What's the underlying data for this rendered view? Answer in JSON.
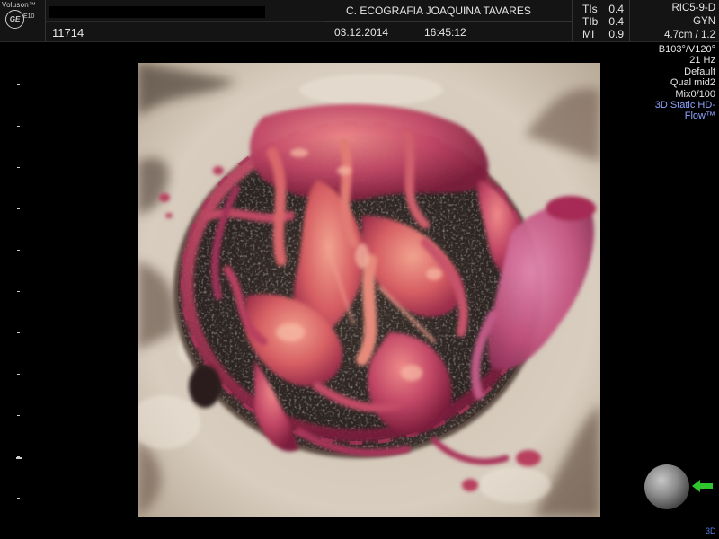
{
  "header": {
    "brand": "Voluson™",
    "model": "E10",
    "logo": "GE",
    "patient_id": "11714",
    "clinic": "C. ECOGRAFIA JOAQUINA TAVARES",
    "date": "03.12.2014",
    "time": "16:45:12",
    "indices": [
      {
        "label": "TIs",
        "value": "0.4"
      },
      {
        "label": "TIb",
        "value": "0.4"
      },
      {
        "label": "MI",
        "value": "0.9"
      }
    ]
  },
  "right_panel": {
    "probe": "RIC5-9-D",
    "application": "GYN",
    "depth": "4.7cm / 1.2",
    "angles": "B103°/V120°",
    "frame_rate": "21 Hz",
    "preset": "Default",
    "quality": "Qual mid2",
    "mix": "Mix0/100",
    "mode_line1": "3D Static HD-",
    "mode_line2": "Flow™"
  },
  "corner": {
    "label": "3D"
  },
  "icons": {
    "orientation": "orientation-sphere-icon",
    "arrow": "green-arrow-left-icon"
  },
  "colors": {
    "mode_text": "#8fa4ff",
    "arrow": "#2fc52f",
    "flow": "#b73a5e"
  }
}
